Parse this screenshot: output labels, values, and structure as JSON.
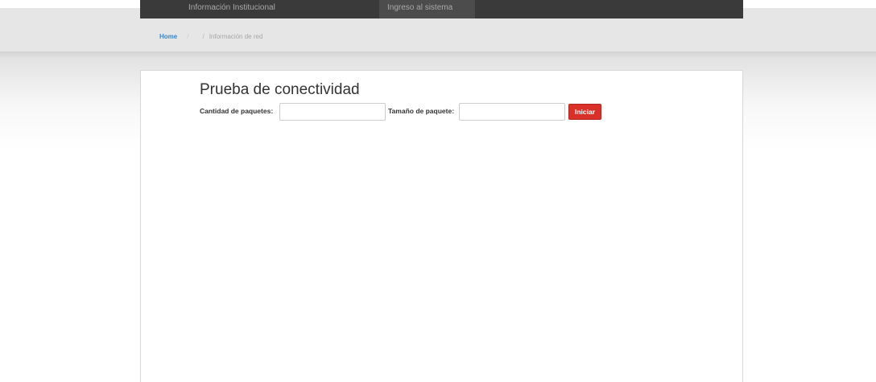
{
  "nav": {
    "items": [
      {
        "label": "Información Institucional"
      },
      {
        "label": "Ingreso al sistema"
      }
    ]
  },
  "breadcrumb": {
    "home": "Home",
    "separator": "/",
    "current": "Información de red"
  },
  "main": {
    "title": "Prueba de conectividad",
    "form": {
      "packets_label": "Cantidad de paquetes:",
      "packets_value": "",
      "packet_size_label": "Tamaño de paquete:",
      "packet_size_value": "",
      "submit_label": "Iniciar"
    }
  },
  "colors": {
    "nav_background": "#3a3a3a",
    "link": "#3a87c8",
    "button": "#d9302a"
  }
}
